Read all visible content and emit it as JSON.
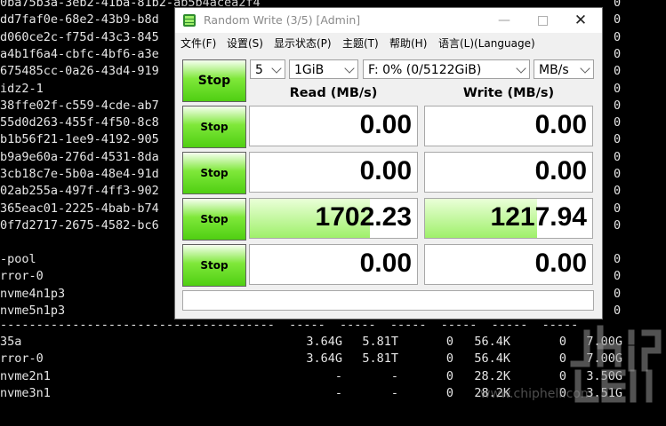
{
  "terminal": {
    "lines": [
      "0ba75b3a-3eb2-41ba-81b2-ab5b4acea2f4",
      "dd7faf0e-68e2-43b9-b8d",
      "d060ce2c-f75d-43c3-845",
      "a4b1f6a4-cbfc-4bf6-a3e",
      "675485cc-0a26-43d4-919",
      "idz2-1",
      "38ffe02f-c559-4cde-ab7",
      "55d0d263-455f-4f50-8c8",
      "b1b56f21-1ee9-4192-905",
      "b9a9e60a-276d-4531-8da",
      "3cb18c7e-5b0a-48e4-91d",
      "02ab255a-497f-4ff3-902",
      "365eac01-2225-4bab-b74",
      "0f7d2717-2675-4582-bc6"
    ],
    "right_col": [
      "0",
      "0",
      "0",
      "0",
      "0",
      "0",
      "0",
      "0",
      "0",
      "0",
      "0",
      "0",
      "0",
      "0"
    ],
    "pool_lines": [
      "-pool",
      "rror-0",
      "nvme4n1p3",
      "nvme5n1p3"
    ],
    "pool_right": [
      "0",
      "0",
      "0",
      "0"
    ],
    "dash_line": "--------------------------------------  -----  -----  -----  -----  -----  -----",
    "rows": [
      {
        "name": "35a",
        "c1": "3.64G",
        "c2": "5.81T",
        "c3": "0",
        "c4": "56.4K",
        "c5": "0",
        "c6": "7.00G"
      },
      {
        "name": "rror-0",
        "c1": "3.64G",
        "c2": "5.81T",
        "c3": "0",
        "c4": "56.4K",
        "c5": "0",
        "c6": "7.00G"
      },
      {
        "name": "nvme2n1",
        "c1": "-",
        "c2": "-",
        "c3": "0",
        "c4": "28.2K",
        "c5": "0",
        "c6": "3.50G"
      },
      {
        "name": "nvme3n1",
        "c1": "-",
        "c2": "-",
        "c3": "0",
        "c4": "28.2K",
        "c5": "0",
        "c6": "3.51G"
      }
    ],
    "top_partial": [
      "0",
      "0"
    ],
    "watermark": "www.chiphell.com"
  },
  "window": {
    "title": "Random Write (3/5) [Admin]",
    "minimize": "—",
    "close": "✕",
    "menu": [
      "文件(F)",
      "设置(S)",
      "显示状态(P)",
      "主题(T)",
      "帮助(H)",
      "语言(L)(Language)"
    ],
    "stop_labels": [
      "Stop",
      "Stop",
      "Stop",
      "Stop",
      "Stop"
    ],
    "controls": {
      "count": "5",
      "size": "1GiB",
      "drive": "F: 0% (0/5122GiB)",
      "unit": "MB/s"
    },
    "headers": {
      "read": "Read (MB/s)",
      "write": "Write (MB/s)"
    },
    "results": [
      {
        "read": "0.00",
        "write": "0.00",
        "read_fill": 0,
        "write_fill": 0
      },
      {
        "read": "0.00",
        "write": "0.00",
        "read_fill": 0,
        "write_fill": 0
      },
      {
        "read": "1702.23",
        "write": "1217.94",
        "read_fill": 0.72,
        "write_fill": 0.67
      },
      {
        "read": "0.00",
        "write": "0.00",
        "read_fill": 0,
        "write_fill": 0
      }
    ],
    "status": "",
    "colors": {
      "accent_green": "#4fcf12",
      "bar_green": "#9ff06a"
    }
  }
}
